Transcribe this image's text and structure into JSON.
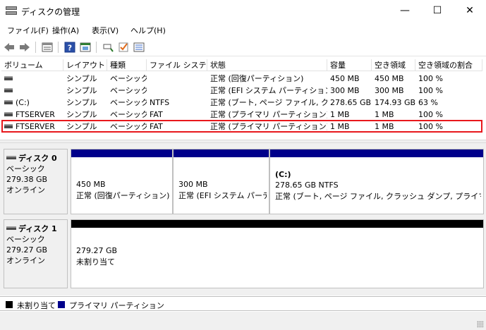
{
  "window": {
    "title": "ディスクの管理",
    "controls": {
      "minimize": "—",
      "maximize": "☐",
      "close": "✕"
    }
  },
  "menu": [
    "ファイル(F)",
    "操作(A)",
    "表示(V)",
    "ヘルプ(H)"
  ],
  "toolbar": {
    "icons": [
      "back-arrow-icon",
      "forward-arrow-icon",
      "list-view-icon",
      "help-icon",
      "properties-icon",
      "connect-icon",
      "check-icon",
      "settings-icon"
    ]
  },
  "volume_table": {
    "headers": [
      "ボリューム",
      "レイアウト",
      "種類",
      "ファイル システム",
      "状態",
      "容量",
      "空き領域",
      "空き領域の割合"
    ],
    "rows": [
      {
        "volume": "",
        "layout": "シンプル",
        "type": "ベーシック",
        "fs": "",
        "status": "正常 (回復パーティション)",
        "capacity": "450 MB",
        "free": "450 MB",
        "pct": "100 %"
      },
      {
        "volume": "",
        "layout": "シンプル",
        "type": "ベーシック",
        "fs": "",
        "status": "正常 (EFI システム パーティション)",
        "capacity": "300 MB",
        "free": "300 MB",
        "pct": "100 %"
      },
      {
        "volume": "(C:)",
        "layout": "シンプル",
        "type": "ベーシック",
        "fs": "NTFS",
        "status": "正常 (ブート, ページ ファイル, クラ...",
        "capacity": "278.65 GB",
        "free": "174.93 GB",
        "pct": "63 %"
      },
      {
        "volume": "FTSERVER",
        "layout": "シンプル",
        "type": "ベーシック",
        "fs": "FAT",
        "status": "正常 (プライマリ パーティション)",
        "capacity": "1 MB",
        "free": "1 MB",
        "pct": "100 %"
      },
      {
        "volume": "FTSERVER",
        "layout": "シンプル",
        "type": "ベーシック",
        "fs": "FAT",
        "status": "正常 (プライマリ パーティション)",
        "capacity": "1 MB",
        "free": "1 MB",
        "pct": "100 %"
      }
    ]
  },
  "disks": [
    {
      "name": "ディスク 0",
      "type": "ベーシック",
      "size": "279.38 GB",
      "state": "オンライン",
      "partitions": [
        {
          "title": "",
          "size": "450 MB",
          "status": "正常 (回復パーティション)"
        },
        {
          "title": "",
          "size": "300 MB",
          "status": "正常 (EFI システム パーティ"
        },
        {
          "title": "(C:)",
          "size": "278.65 GB NTFS",
          "status": "正常 (ブート, ページ ファイル, クラッシュ ダンプ, プライマリ パーテ"
        }
      ]
    },
    {
      "name": "ディスク 1",
      "type": "ベーシック",
      "size": "279.27 GB",
      "state": "オンライン",
      "partitions": [
        {
          "title": "",
          "size": "279.27 GB",
          "status": "未割り当て"
        }
      ]
    }
  ],
  "legend": [
    {
      "label": "未割り当て",
      "color": "#000000"
    },
    {
      "label": "プライマリ パーティション",
      "color": "#00008b"
    }
  ],
  "colors": {
    "primary": "#00008b",
    "unallocated": "#000000",
    "highlight": "#e8181c"
  }
}
